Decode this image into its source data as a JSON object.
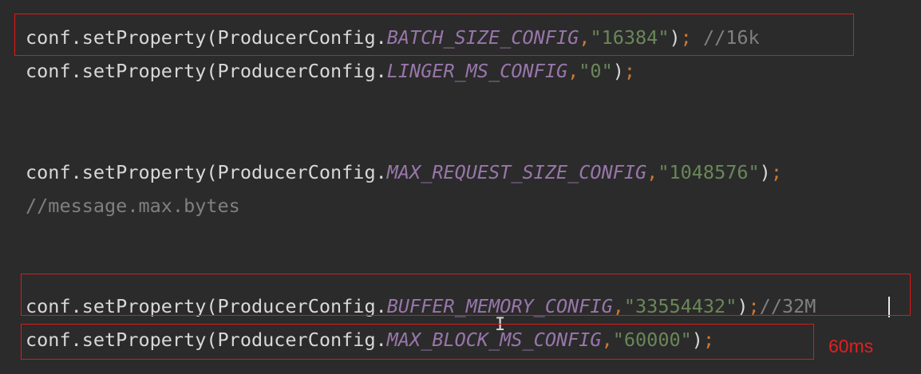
{
  "code": {
    "lines": [
      {
        "prefix": "conf.setProperty(ProducerConfig.",
        "constant": "BATCH_SIZE_CONFIG",
        "comma": ",",
        "value": "\"16384\"",
        "close": ")",
        "semi": ";",
        "comment": " //16k"
      },
      {
        "prefix": "conf.setProperty(ProducerConfig.",
        "constant": "LINGER_MS_CONFIG",
        "comma": ",",
        "value": "\"0\"",
        "close": ")",
        "semi": ";"
      },
      {
        "prefix": "conf.setProperty(ProducerConfig.",
        "constant": "MAX_REQUEST_SIZE_CONFIG",
        "comma": ",",
        "value": "\"1048576\"",
        "close": ")",
        "semi": ";"
      },
      {
        "comment": "//message.max.bytes"
      },
      {
        "prefix": "conf.setProperty(ProducerConfig.",
        "constant": "BUFFER_MEMORY_CONFIG",
        "comma": ",",
        "value": "\"33554432\"",
        "close": ")",
        "semi": ";",
        "comment": "//32M"
      },
      {
        "prefix": "conf.setProperty(ProducerConfig.",
        "constant": "MAX_BLOCK_MS_CONFIG",
        "comma": ",",
        "value": "\"60000\"",
        "close": ")",
        "semi": ";"
      }
    ]
  },
  "annotations": {
    "block_ms_note": "60ms"
  },
  "colors": {
    "background": "#2b2b2b",
    "text": "#d8d8d8",
    "constant": "#9876aa",
    "string": "#6a8759",
    "punctuation": "#cc7832",
    "comment": "#808080",
    "highlight_box": "#e01818"
  }
}
